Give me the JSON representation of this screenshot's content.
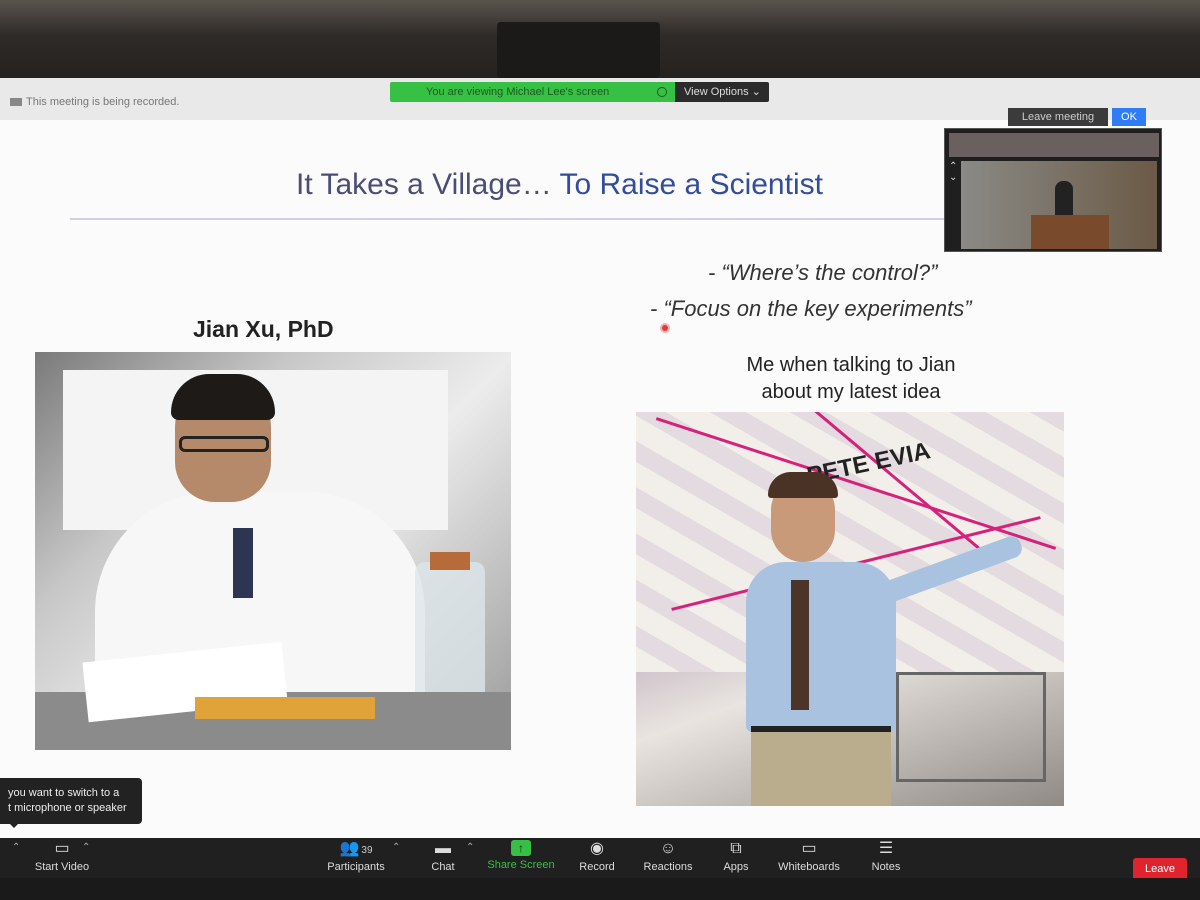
{
  "share_banner": {
    "text": "You are viewing Michael Lee's screen",
    "view_options": "View Options"
  },
  "recording_note": "This meeting is being recorded.",
  "leave_meeting_label": "Leave meeting",
  "ok_label": "OK",
  "slide": {
    "title_part1": "It Takes a Village…",
    "title_part2": "To Raise a Scientist",
    "quote1": "- “Where’s the control?”",
    "quote2": "- “Focus on the key experiments”",
    "person_name": "Jian Xu, PhD",
    "meme_caption_line1": "Me when talking to Jian",
    "meme_caption_line2": "about my latest idea",
    "meme_sign_text": "PETE EVIA"
  },
  "tooltip": {
    "line1": "you want to switch to a",
    "line2": "t microphone or speaker"
  },
  "toolbar": {
    "start_video": "Start Video",
    "participants": "Participants",
    "participants_count": "39",
    "chat": "Chat",
    "share_screen": "Share Screen",
    "record": "Record",
    "reactions": "Reactions",
    "apps": "Apps",
    "whiteboards": "Whiteboards",
    "notes": "Notes",
    "leave": "Leave"
  },
  "colors": {
    "share_green": "#36c144",
    "leave_red": "#e0242e",
    "title_blue": "#324d9a"
  }
}
